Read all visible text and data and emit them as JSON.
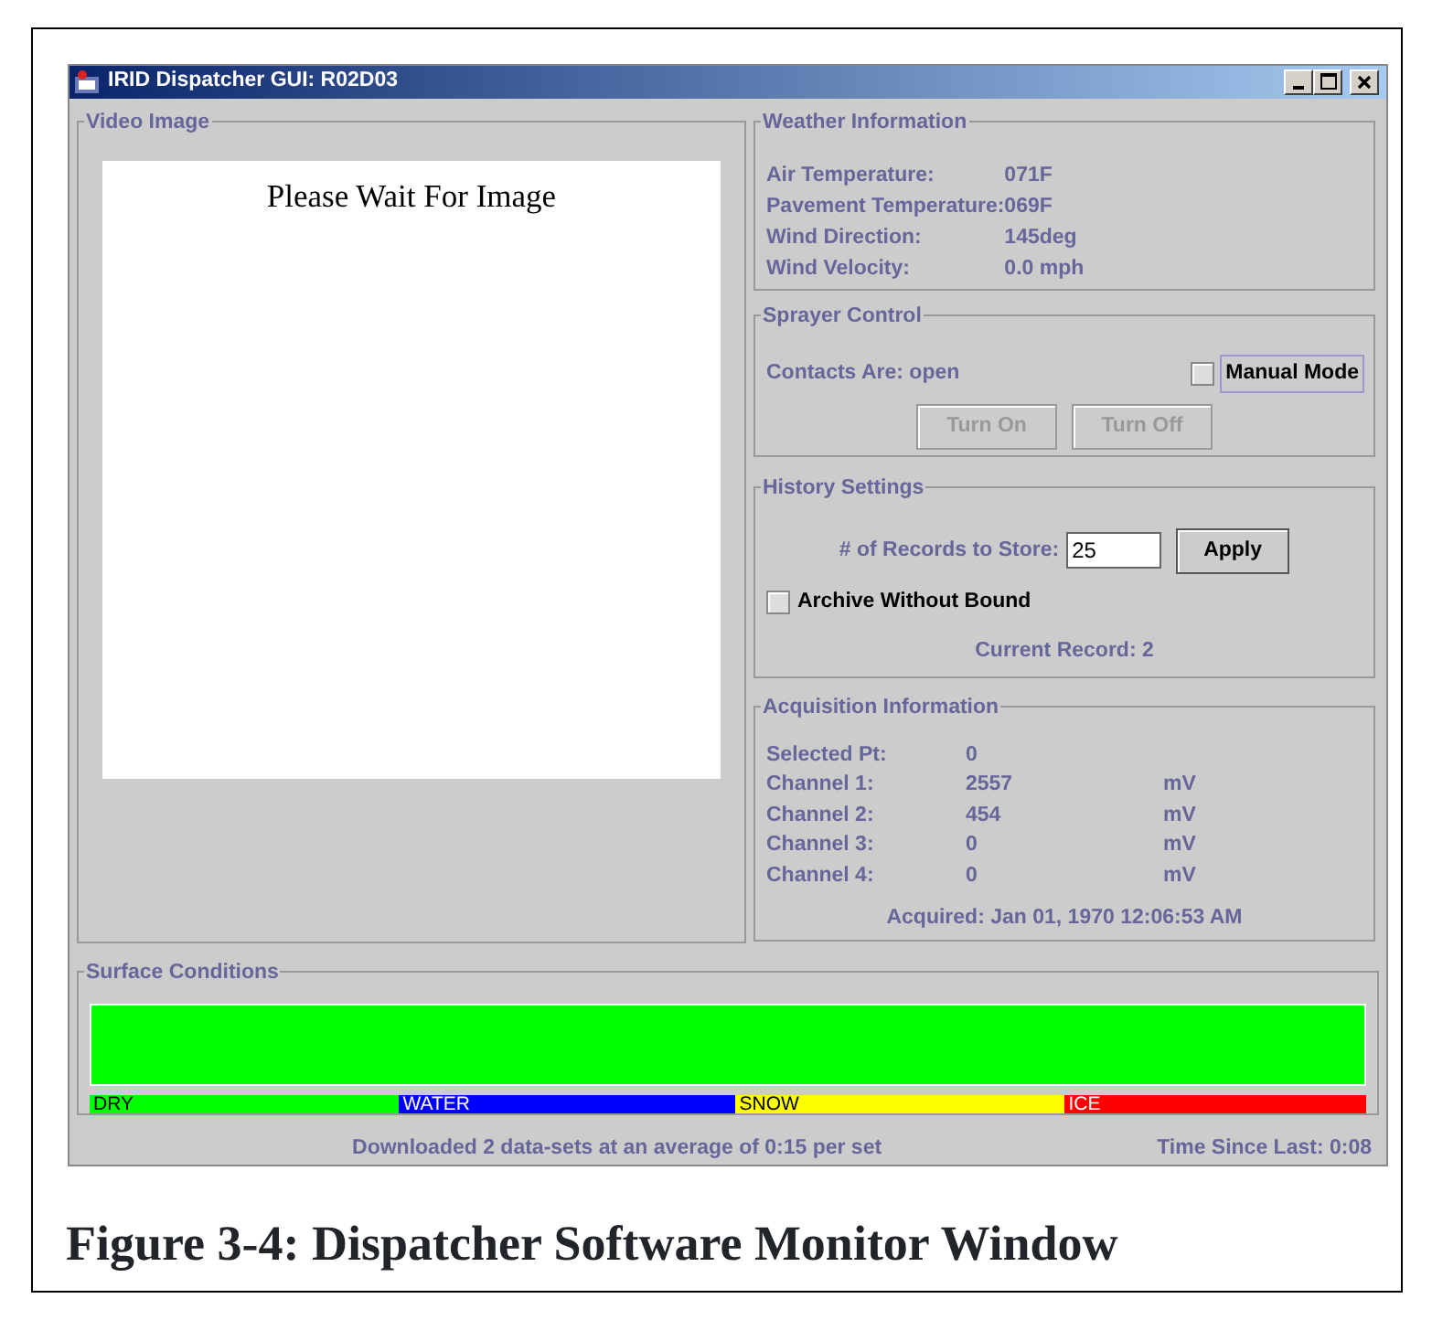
{
  "window": {
    "title": "IRID Dispatcher GUI: R02D03"
  },
  "video_image": {
    "title": "Video Image",
    "message": "Please Wait For Image"
  },
  "weather_information": {
    "title": "Weather Information",
    "rows": [
      {
        "label": "Air Temperature:",
        "value": "071F"
      },
      {
        "label": "Pavement Temperature:",
        "value": "069F"
      },
      {
        "label": "Wind Direction:",
        "value": "145deg"
      },
      {
        "label": "Wind Velocity:",
        "value": "0.0 mph"
      }
    ]
  },
  "sprayer_control": {
    "title": "Sprayer Control",
    "status": "Contacts Are: open",
    "manual_mode": {
      "label": "Manual Mode",
      "checked": false,
      "focused": true
    },
    "buttons": [
      {
        "label": "Turn On",
        "disabled": true
      },
      {
        "label": "Turn Off",
        "disabled": true
      }
    ]
  },
  "history_settings": {
    "title": "History Settings",
    "records_label": "# of Records to Store:",
    "records_value": "25",
    "apply": "Apply",
    "archive": {
      "label": "Archive Without Bound",
      "checked": false
    },
    "current_record": "Current Record: 2"
  },
  "acquisition_information": {
    "title": "Acquisition Information",
    "rows": [
      {
        "label": "Selected Pt:",
        "value": "0"
      },
      {
        "label": "Channel 1:",
        "value": "2557",
        "unit": "mV"
      },
      {
        "label": "Channel 2:",
        "value": "454",
        "unit": "mV"
      },
      {
        "label": "Channel 3:",
        "value": "0",
        "unit": "mV"
      },
      {
        "label": "Channel 4:",
        "value": "0",
        "unit": "mV"
      }
    ],
    "acquired": "Acquired: Jan 01, 1970 12:06:53 AM"
  },
  "surface_conditions": {
    "title": "Surface Conditions",
    "legend": [
      {
        "label": "DRY",
        "color": "#00ff00",
        "selected": true
      },
      {
        "label": "WATER",
        "color": "#0000ff",
        "selected": false
      },
      {
        "label": "SNOW",
        "color": "#ffff00",
        "selected": false
      },
      {
        "label": "ICE",
        "color": "#ff0000",
        "selected": false
      }
    ]
  },
  "status_bar": {
    "message": "Downloaded 2 data-sets at an average of 0:15 per set",
    "time_since_last": "Time Since Last: 0:08"
  },
  "caption": "Figure 3-4: Dispatcher Software Monitor Window"
}
